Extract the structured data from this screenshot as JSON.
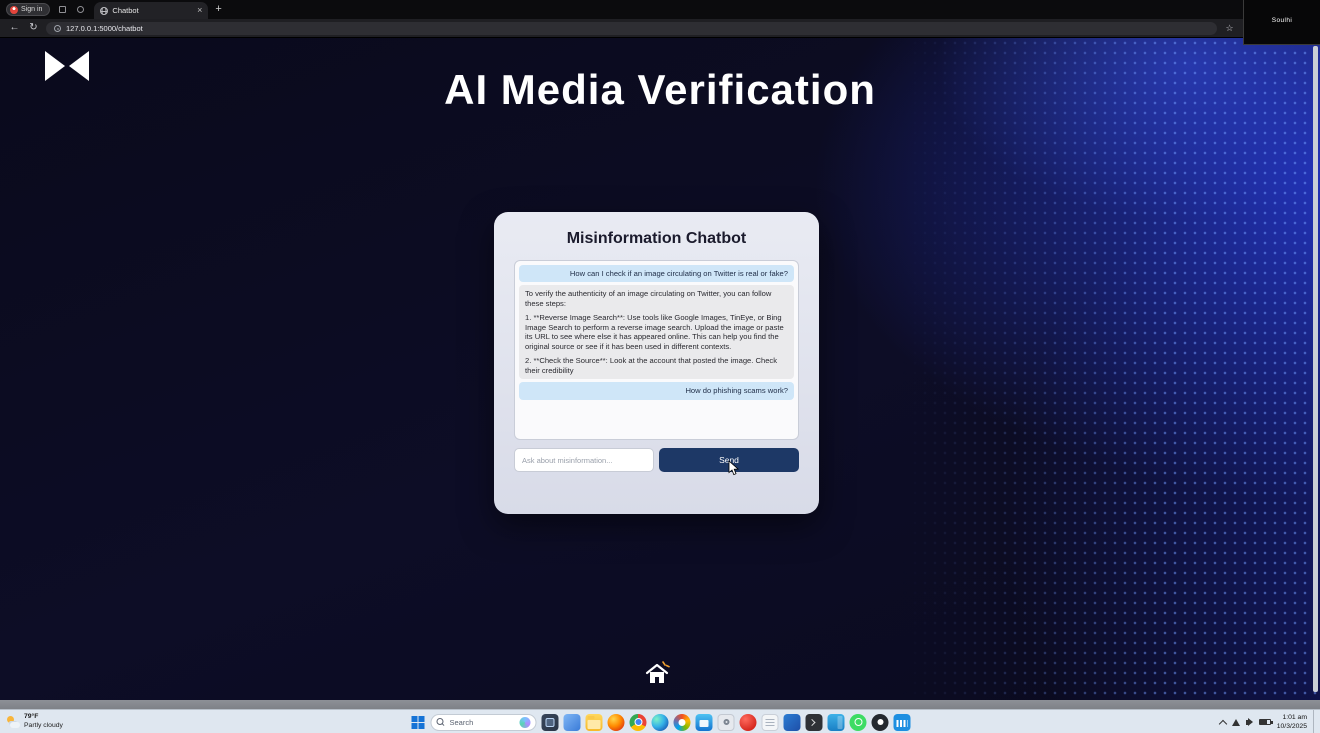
{
  "overlay": {
    "label": "Soulhi"
  },
  "browser": {
    "signin_label": "Sign in",
    "tab_title": "Chatbot",
    "url": "127.0.0.1:5000/chatbot"
  },
  "icons": {
    "close": "×",
    "new_tab": "+",
    "back": "←",
    "refresh": "↻",
    "star": "☆"
  },
  "page": {
    "title": "AI Media Verification",
    "chatbot": {
      "title": "Misinformation Chatbot",
      "messages": [
        {
          "role": "user",
          "text": "How can I check if an image circulating on Twitter is real or fake?"
        },
        {
          "role": "bot",
          "paragraphs": [
            "To verify the authenticity of an image circulating on Twitter, you can follow these steps:",
            "1. **Reverse Image Search**: Use tools like Google Images, TinEye, or Bing Image Search to perform a reverse image search. Upload the image or paste its URL to see where else it has appeared online. This can help you find the original source or see if it has been used in different contexts.",
            "2. **Check the Source**: Look at the account that posted the image. Check their credibility"
          ]
        },
        {
          "role": "user",
          "text": "How do phishing scams work?"
        }
      ],
      "input_placeholder": "Ask about misinformation...",
      "send_label": "Send"
    }
  },
  "taskbar": {
    "weather": {
      "temp": "79°F",
      "condition": "Partly cloudy"
    },
    "search_placeholder": "Search",
    "clock": {
      "time": "1:01 am",
      "date": "10/3/2025"
    }
  }
}
